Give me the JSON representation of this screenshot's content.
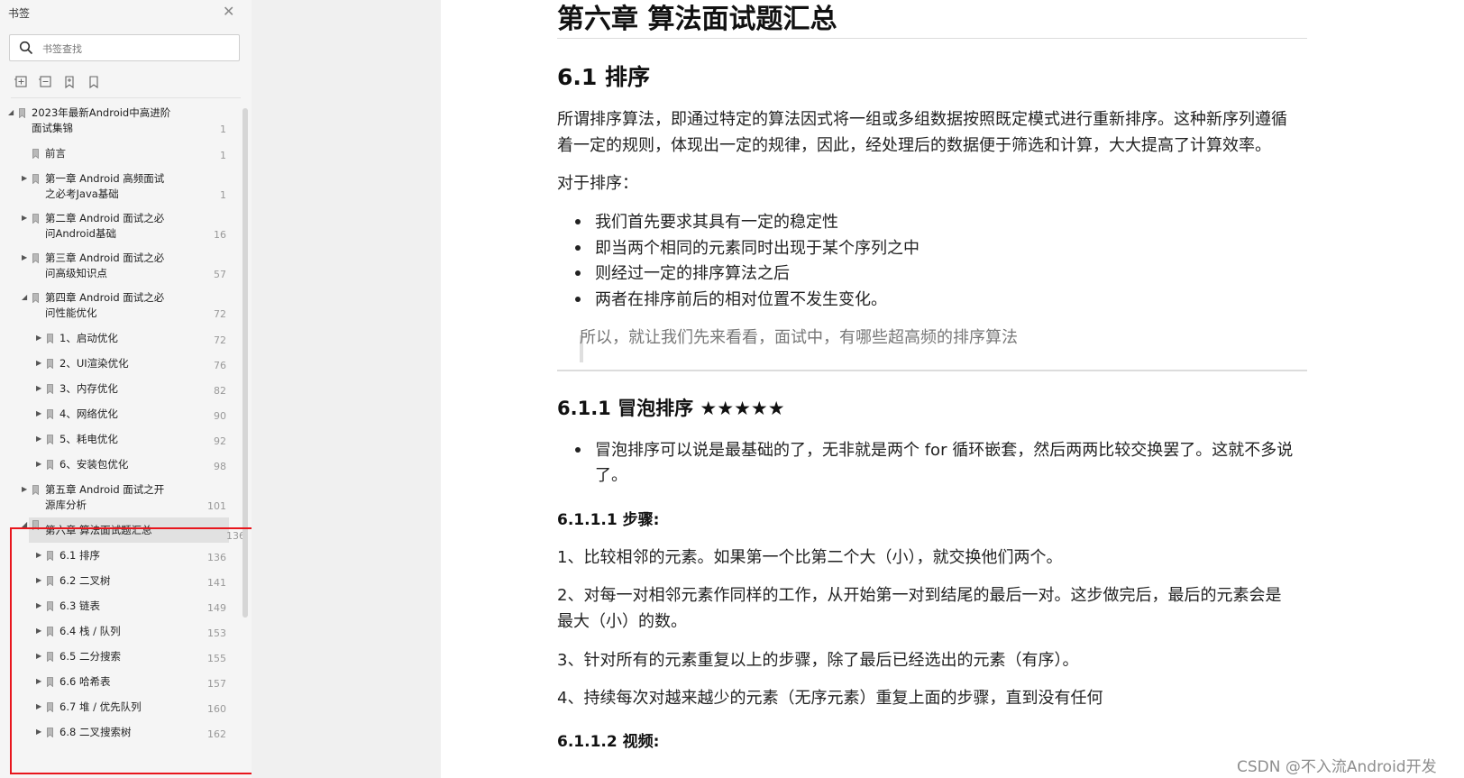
{
  "sidebar": {
    "title": "书签",
    "close_icon": "close-icon",
    "search": {
      "placeholder": "书签查找",
      "value": ""
    },
    "toolbar": [
      "expand-all-icon",
      "collapse-all-icon",
      "add-bookmark-icon",
      "bookmark-icon"
    ],
    "items": [
      {
        "l1": "2023年最新Android中高进阶",
        "l2": "面试集锦",
        "page": "1",
        "expanded": true
      },
      {
        "l1": "前言",
        "page": "1",
        "expanded": null
      },
      {
        "l1": "第一章 Android 高频面试",
        "l2": "之必考Java基础",
        "page": "1",
        "expanded": false
      },
      {
        "l1": "第二章 Android 面试之必",
        "l2": "问Android基础",
        "page": "16",
        "expanded": false
      },
      {
        "l1": "第三章 Android 面试之必",
        "l2": "问高级知识点",
        "page": "57",
        "expanded": false
      },
      {
        "l1": "第四章 Android 面试之必",
        "l2": "问性能优化",
        "page": "72",
        "expanded": true
      },
      {
        "l1": "1、启动优化",
        "page": "72",
        "expanded": false
      },
      {
        "l1": "2、UI渲染优化",
        "page": "76",
        "expanded": false
      },
      {
        "l1": "3、内存优化",
        "page": "82",
        "expanded": false
      },
      {
        "l1": "4、网络优化",
        "page": "90",
        "expanded": false
      },
      {
        "l1": "5、耗电优化",
        "page": "92",
        "expanded": false
      },
      {
        "l1": "6、安装包优化",
        "page": "98",
        "expanded": false
      },
      {
        "l1": "第五章 Android 面试之开",
        "l2": "源库分析",
        "page": "101",
        "expanded": false
      },
      {
        "l1": "第六章 算法面试题汇总",
        "page": "136",
        "expanded": true,
        "selected": true
      },
      {
        "l1": "6.1 排序",
        "page": "136",
        "expanded": false
      },
      {
        "l1": "6.2 二叉树",
        "page": "141",
        "expanded": false
      },
      {
        "l1": "6.3 链表",
        "page": "149",
        "expanded": false
      },
      {
        "l1": "6.4 栈 / 队列",
        "page": "153",
        "expanded": false
      },
      {
        "l1": "6.5 二分搜索",
        "page": "155",
        "expanded": false
      },
      {
        "l1": "6.6 哈希表",
        "page": "157",
        "expanded": false
      },
      {
        "l1": "6.7 堆 / 优先队列",
        "page": "160",
        "expanded": false
      },
      {
        "l1": "6.8 二叉搜索树",
        "page": "162",
        "expanded": false
      }
    ],
    "highlight_color": "#e8161d"
  },
  "document": {
    "h1": "第六章 算法面试题汇总",
    "h2": "6.1 排序",
    "intro_line1": "所谓排序算法，即通过特定的算法因式将一组或多组数据按照既定模式进行重新排序。这种新序列遵循",
    "intro_line2": "着一定的规则，体现出一定的规律，因此，经处理后的数据便于筛选和计算，大大提高了计算效率。",
    "for_sort": "对于排序：",
    "bullets": [
      "我们首先要求其具有一定的稳定性",
      "即当两个相同的元素同时出现于某个序列之中",
      "则经过一定的排序算法之后",
      "两者在排序前后的相对位置不发生变化。"
    ],
    "quote": "所以，就让我们先来看看，面试中，有哪些超高频的排序算法",
    "h3": "6.1.1 冒泡排序 ★★★★★",
    "bubble_line1": "冒泡排序可以说是最基础的了，无非就是两个 for 循环嵌套，然后两两比较交换罢了。这就不多说",
    "bubble_line2": "了。",
    "h4_steps": "6.1.1.1 步骤:",
    "step1": "1、比较相邻的元素。如果第一个比第二个大（小），就交换他们两个。",
    "step2_line1": "2、对每一对相邻元素作同样的工作，从开始第一对到结尾的最后一对。这步做完后，最后的元素会是",
    "step2_line2": "最大（小）的数。",
    "step3": "3、针对所有的元素重复以上的步骤，除了最后已经选出的元素（有序）。",
    "step4": "4、持续每次对越来越少的元素（无序元素）重复上面的步骤，直到没有任何",
    "h4_video": "6.1.1.2 视频:"
  },
  "watermark": "CSDN @不入流Android开发"
}
